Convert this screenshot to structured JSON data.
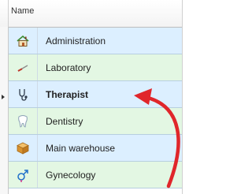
{
  "grid": {
    "column_header": "Name",
    "selected_index": 2,
    "rows": [
      {
        "label": "Administration",
        "icon": "house-icon"
      },
      {
        "label": "Laboratory",
        "icon": "pipette-icon"
      },
      {
        "label": "Therapist",
        "icon": "stethoscope-icon"
      },
      {
        "label": "Dentistry",
        "icon": "tooth-icon"
      },
      {
        "label": "Main warehouse",
        "icon": "box-icon"
      },
      {
        "label": "Gynecology",
        "icon": "gender-icon"
      }
    ]
  },
  "colors": {
    "row_blue": "#dcefff",
    "row_green": "#e3f7e3",
    "arrow": "#e0262b"
  }
}
